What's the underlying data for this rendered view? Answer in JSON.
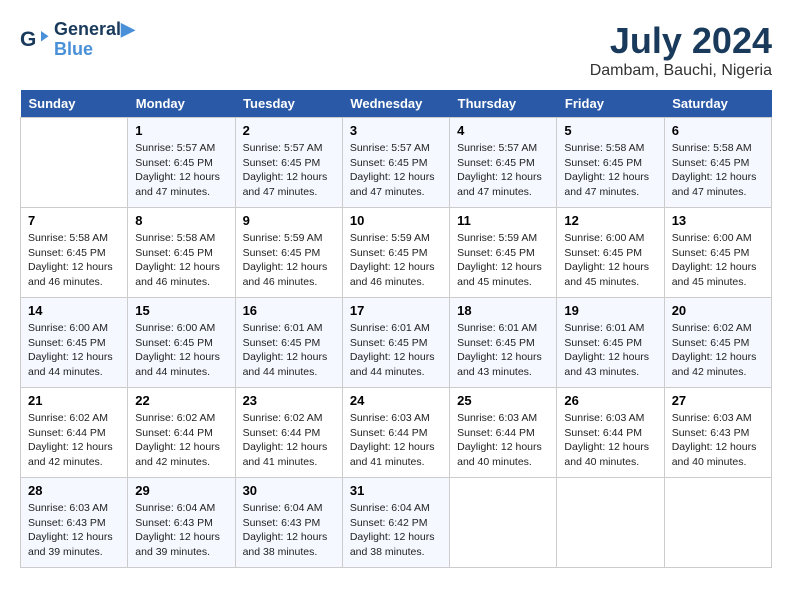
{
  "header": {
    "logo_line1": "General",
    "logo_line2": "Blue",
    "month_year": "July 2024",
    "location": "Dambam, Bauchi, Nigeria"
  },
  "weekdays": [
    "Sunday",
    "Monday",
    "Tuesday",
    "Wednesday",
    "Thursday",
    "Friday",
    "Saturday"
  ],
  "weeks": [
    [
      {
        "day": "",
        "sunrise": "",
        "sunset": "",
        "daylight": ""
      },
      {
        "day": "1",
        "sunrise": "5:57 AM",
        "sunset": "6:45 PM",
        "daylight": "12 hours and 47 minutes."
      },
      {
        "day": "2",
        "sunrise": "5:57 AM",
        "sunset": "6:45 PM",
        "daylight": "12 hours and 47 minutes."
      },
      {
        "day": "3",
        "sunrise": "5:57 AM",
        "sunset": "6:45 PM",
        "daylight": "12 hours and 47 minutes."
      },
      {
        "day": "4",
        "sunrise": "5:57 AM",
        "sunset": "6:45 PM",
        "daylight": "12 hours and 47 minutes."
      },
      {
        "day": "5",
        "sunrise": "5:58 AM",
        "sunset": "6:45 PM",
        "daylight": "12 hours and 47 minutes."
      },
      {
        "day": "6",
        "sunrise": "5:58 AM",
        "sunset": "6:45 PM",
        "daylight": "12 hours and 47 minutes."
      }
    ],
    [
      {
        "day": "7",
        "sunrise": "5:58 AM",
        "sunset": "6:45 PM",
        "daylight": "12 hours and 46 minutes."
      },
      {
        "day": "8",
        "sunrise": "5:58 AM",
        "sunset": "6:45 PM",
        "daylight": "12 hours and 46 minutes."
      },
      {
        "day": "9",
        "sunrise": "5:59 AM",
        "sunset": "6:45 PM",
        "daylight": "12 hours and 46 minutes."
      },
      {
        "day": "10",
        "sunrise": "5:59 AM",
        "sunset": "6:45 PM",
        "daylight": "12 hours and 46 minutes."
      },
      {
        "day": "11",
        "sunrise": "5:59 AM",
        "sunset": "6:45 PM",
        "daylight": "12 hours and 45 minutes."
      },
      {
        "day": "12",
        "sunrise": "6:00 AM",
        "sunset": "6:45 PM",
        "daylight": "12 hours and 45 minutes."
      },
      {
        "day": "13",
        "sunrise": "6:00 AM",
        "sunset": "6:45 PM",
        "daylight": "12 hours and 45 minutes."
      }
    ],
    [
      {
        "day": "14",
        "sunrise": "6:00 AM",
        "sunset": "6:45 PM",
        "daylight": "12 hours and 44 minutes."
      },
      {
        "day": "15",
        "sunrise": "6:00 AM",
        "sunset": "6:45 PM",
        "daylight": "12 hours and 44 minutes."
      },
      {
        "day": "16",
        "sunrise": "6:01 AM",
        "sunset": "6:45 PM",
        "daylight": "12 hours and 44 minutes."
      },
      {
        "day": "17",
        "sunrise": "6:01 AM",
        "sunset": "6:45 PM",
        "daylight": "12 hours and 44 minutes."
      },
      {
        "day": "18",
        "sunrise": "6:01 AM",
        "sunset": "6:45 PM",
        "daylight": "12 hours and 43 minutes."
      },
      {
        "day": "19",
        "sunrise": "6:01 AM",
        "sunset": "6:45 PM",
        "daylight": "12 hours and 43 minutes."
      },
      {
        "day": "20",
        "sunrise": "6:02 AM",
        "sunset": "6:45 PM",
        "daylight": "12 hours and 42 minutes."
      }
    ],
    [
      {
        "day": "21",
        "sunrise": "6:02 AM",
        "sunset": "6:44 PM",
        "daylight": "12 hours and 42 minutes."
      },
      {
        "day": "22",
        "sunrise": "6:02 AM",
        "sunset": "6:44 PM",
        "daylight": "12 hours and 42 minutes."
      },
      {
        "day": "23",
        "sunrise": "6:02 AM",
        "sunset": "6:44 PM",
        "daylight": "12 hours and 41 minutes."
      },
      {
        "day": "24",
        "sunrise": "6:03 AM",
        "sunset": "6:44 PM",
        "daylight": "12 hours and 41 minutes."
      },
      {
        "day": "25",
        "sunrise": "6:03 AM",
        "sunset": "6:44 PM",
        "daylight": "12 hours and 40 minutes."
      },
      {
        "day": "26",
        "sunrise": "6:03 AM",
        "sunset": "6:44 PM",
        "daylight": "12 hours and 40 minutes."
      },
      {
        "day": "27",
        "sunrise": "6:03 AM",
        "sunset": "6:43 PM",
        "daylight": "12 hours and 40 minutes."
      }
    ],
    [
      {
        "day": "28",
        "sunrise": "6:03 AM",
        "sunset": "6:43 PM",
        "daylight": "12 hours and 39 minutes."
      },
      {
        "day": "29",
        "sunrise": "6:04 AM",
        "sunset": "6:43 PM",
        "daylight": "12 hours and 39 minutes."
      },
      {
        "day": "30",
        "sunrise": "6:04 AM",
        "sunset": "6:43 PM",
        "daylight": "12 hours and 38 minutes."
      },
      {
        "day": "31",
        "sunrise": "6:04 AM",
        "sunset": "6:42 PM",
        "daylight": "12 hours and 38 minutes."
      },
      {
        "day": "",
        "sunrise": "",
        "sunset": "",
        "daylight": ""
      },
      {
        "day": "",
        "sunrise": "",
        "sunset": "",
        "daylight": ""
      },
      {
        "day": "",
        "sunrise": "",
        "sunset": "",
        "daylight": ""
      }
    ]
  ]
}
